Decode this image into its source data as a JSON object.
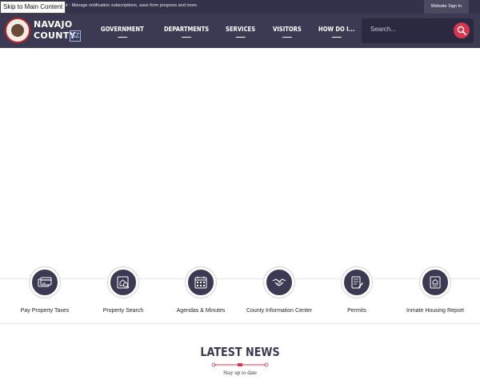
{
  "topbar": {
    "skip_link": "Skip to Main Content",
    "message": "ount - Manage notification subscriptions, save form progress and more.",
    "signin": "Website Sign In"
  },
  "logo": {
    "line1": "NAVAJO",
    "line2": "COUNTY",
    "state": "AZ"
  },
  "nav": {
    "items": [
      "GOVERNMENT",
      "DEPARTMENTS",
      "SERVICES",
      "VISITORS",
      "HOW DO I..."
    ]
  },
  "search": {
    "placeholder": "Search..."
  },
  "quick_links": [
    {
      "label": "Pay Property Taxes",
      "icon": "credit-card-icon"
    },
    {
      "label": "Property Search",
      "icon": "home-search-icon"
    },
    {
      "label": "Agendas & Minutes",
      "icon": "calendar-icon"
    },
    {
      "label": "County Information Center",
      "icon": "handshake-icon"
    },
    {
      "label": "Permits",
      "icon": "document-pen-icon"
    },
    {
      "label": "Inmate Housing Report",
      "icon": "report-icon"
    }
  ],
  "news": {
    "title": "LATEST NEWS",
    "subtitle": "Stay up to date"
  },
  "colors": {
    "nav_bg": "#3c3a53",
    "topbar_bg": "#33324a",
    "accent": "#d8354e"
  }
}
